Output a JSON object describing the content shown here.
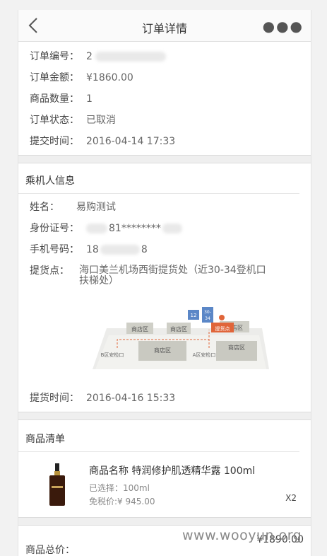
{
  "header": {
    "title": "订单详情"
  },
  "order": {
    "number_label": "订单编号：",
    "number_value": "2",
    "amount_label": "订单金额：",
    "amount_value": "¥1860.00",
    "qty_label": "商品数量：",
    "qty_value": "1",
    "status_label": "订单状态：",
    "status_value": "已取消",
    "time_label": "提交时间：",
    "time_value": "2016-04-14 17:33"
  },
  "passenger": {
    "section_title": "乘机人信息",
    "name_label": "姓名：",
    "name_value": "易购测试",
    "id_label": "身份证号：",
    "id_value": "81********",
    "phone_label": "手机号码：",
    "phone_prefix": "18",
    "phone_suffix": "8",
    "pickup_label": "提货点：",
    "pickup_value": "海口美兰机场西街提货处（近30-34登机口扶梯处）",
    "pickup_time_label": "提货时间：",
    "pickup_time_value": "2016-04-16 15:33"
  },
  "map": {
    "shop1": "商店区",
    "shop2": "商店区",
    "shop3": "商店区",
    "shop4": "商店区",
    "shop5": "商店区",
    "gate12": "12",
    "gate3034_top": "30-",
    "gate3034_bot": "34",
    "pickup": "提货点",
    "security_b": "B区安检口",
    "security_a": "A区安检口"
  },
  "goods": {
    "section_title": "商品清单",
    "name": "商品名称 特润修护肌透精华露 100ml",
    "selected": "已选择：100ml",
    "price": "免税价:¥ 945.00",
    "qty": "X2"
  },
  "total": {
    "label": "商品总价：",
    "value": "¥1890.00"
  },
  "watermark": "www.wooyun.org"
}
